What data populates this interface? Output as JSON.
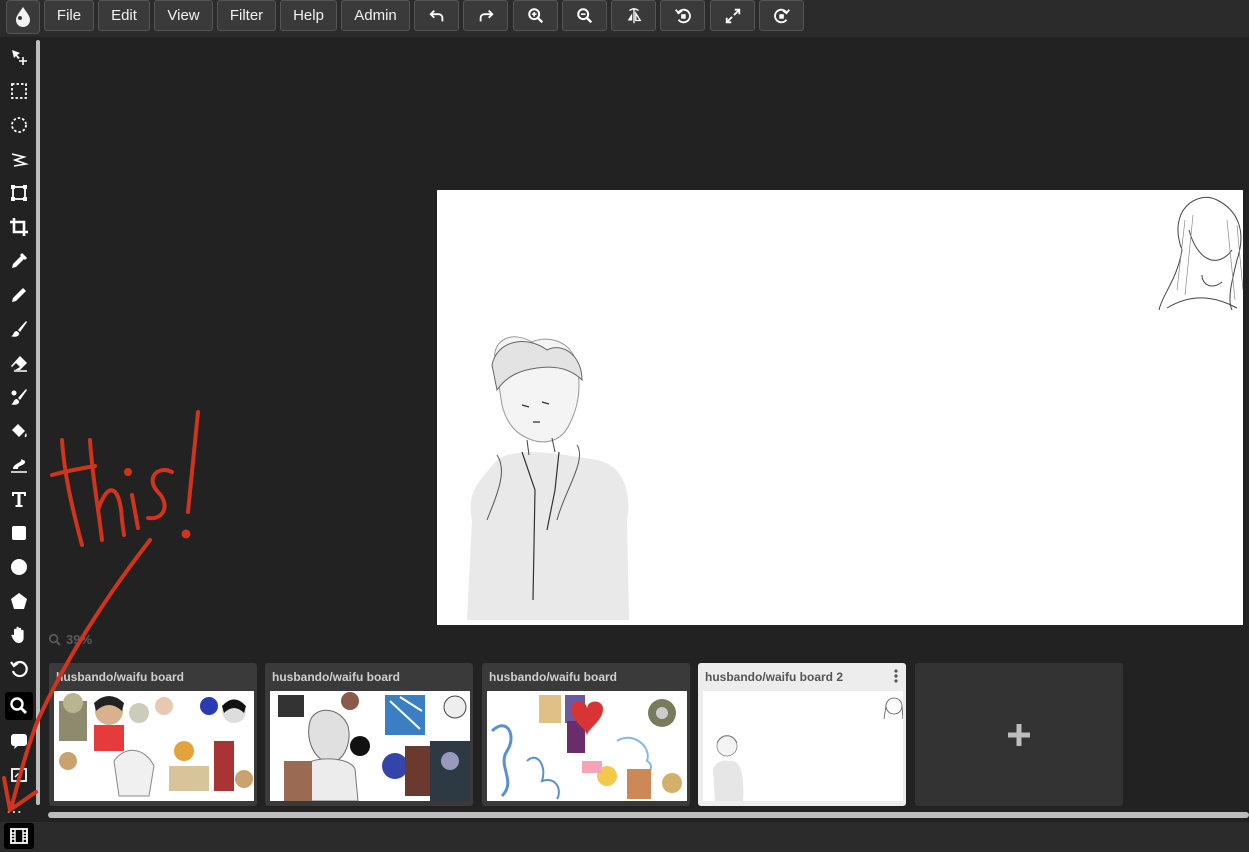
{
  "menu": {
    "items": [
      {
        "label": "File"
      },
      {
        "label": "Edit"
      },
      {
        "label": "View"
      },
      {
        "label": "Filter"
      },
      {
        "label": "Help"
      },
      {
        "label": "Admin"
      }
    ]
  },
  "toolbar_icons": [
    "undo-icon",
    "redo-icon",
    "zoom-in-icon",
    "zoom-out-icon",
    "flip-icon",
    "rotate-left-icon",
    "fullscreen-icon",
    "rotate-right-icon"
  ],
  "left_tools": [
    "move-icon",
    "rect-select-icon",
    "ellipse-select-icon",
    "lasso-icon",
    "transform-icon",
    "crop-icon",
    "eyedropper-icon",
    "pen-icon",
    "brush-icon",
    "eraser-icon",
    "smudge-icon",
    "fill-icon",
    "gradient-icon",
    "text-icon",
    "rectangle-icon",
    "circle-icon",
    "shape-icon",
    "hand-icon",
    "rotate-icon",
    "zoom-icon",
    "speech-bubble-icon",
    "layers-icon"
  ],
  "zoom": {
    "value": "39%"
  },
  "boards": [
    {
      "title": "husbando/waifu board"
    },
    {
      "title": "husbando/waifu board"
    },
    {
      "title": "husbando/waifu board"
    },
    {
      "title": "husbando/waifu board 2"
    }
  ],
  "add_board": {
    "label": "+"
  },
  "more": {
    "label": "⋯"
  },
  "annotation": {
    "text": "this!"
  },
  "colors": {
    "background": "#222222",
    "toolbar": "#2b2b2b",
    "button": "#3a3a3a",
    "annotation": "#d0341c"
  }
}
